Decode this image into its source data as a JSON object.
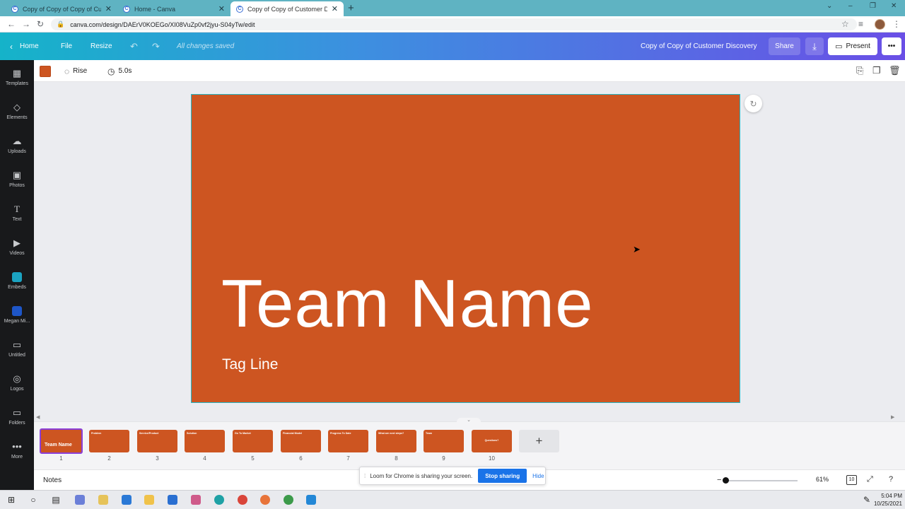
{
  "browser": {
    "tabs": [
      {
        "title": "Copy of Copy of Copy of Custom",
        "active": false
      },
      {
        "title": "Home - Canva",
        "active": false
      },
      {
        "title": "Copy of Copy of Customer Disco",
        "active": true
      }
    ],
    "new_tab_icon": "+",
    "url": "canva.com/design/DAErV0KOEGo/XI08VuZp0vf2jyu-S04yTw/edit"
  },
  "topbar": {
    "home_label": "Home",
    "file_label": "File",
    "resize_label": "Resize",
    "saved_status": "All changes saved",
    "design_title": "Copy of Copy of Customer Discovery",
    "share_label": "Share",
    "present_label": "Present",
    "more_label": "•••"
  },
  "sidebar": {
    "items": [
      {
        "label": "Templates",
        "icon": "templates-icon"
      },
      {
        "label": "Elements",
        "icon": "elements-icon"
      },
      {
        "label": "Uploads",
        "icon": "uploads-icon"
      },
      {
        "label": "Photos",
        "icon": "photos-icon"
      },
      {
        "label": "Text",
        "icon": "text-icon"
      },
      {
        "label": "Videos",
        "icon": "videos-icon"
      },
      {
        "label": "Embeds",
        "icon": "embeds-icon"
      },
      {
        "label": "Megan Mi...",
        "icon": "app-icon"
      },
      {
        "label": "Untitled",
        "icon": "folder-icon"
      },
      {
        "label": "Logos",
        "icon": "logos-icon"
      },
      {
        "label": "Folders",
        "icon": "folder-icon"
      },
      {
        "label": "More",
        "icon": "more-icon"
      }
    ]
  },
  "context_toolbar": {
    "color": "#cd5521",
    "animation_label": "Rise",
    "duration_label": "5.0s"
  },
  "slide": {
    "background": "#cd5521",
    "title": "Team Name",
    "tagline": "Tag Line"
  },
  "pages": [
    {
      "num": "1",
      "title": "Team Name"
    },
    {
      "num": "2",
      "title": "Problem"
    },
    {
      "num": "3",
      "title": "Service/Product"
    },
    {
      "num": "4",
      "title": "Solution"
    },
    {
      "num": "5",
      "title": "Go To Market"
    },
    {
      "num": "6",
      "title": "Financial Model"
    },
    {
      "num": "7",
      "title": "Progress To Date"
    },
    {
      "num": "8",
      "title": "What are next steps?"
    },
    {
      "num": "9",
      "title": "Team"
    },
    {
      "num": "10",
      "title": "Questions?"
    }
  ],
  "footer": {
    "notes_label": "Notes",
    "zoom": "61%",
    "page_count": "10"
  },
  "loom": {
    "message": "Loom for Chrome is sharing your screen.",
    "stop_label": "Stop sharing",
    "hide_label": "Hide"
  },
  "taskbar": {
    "time": "5:04 PM",
    "date": "10/25/2021"
  }
}
